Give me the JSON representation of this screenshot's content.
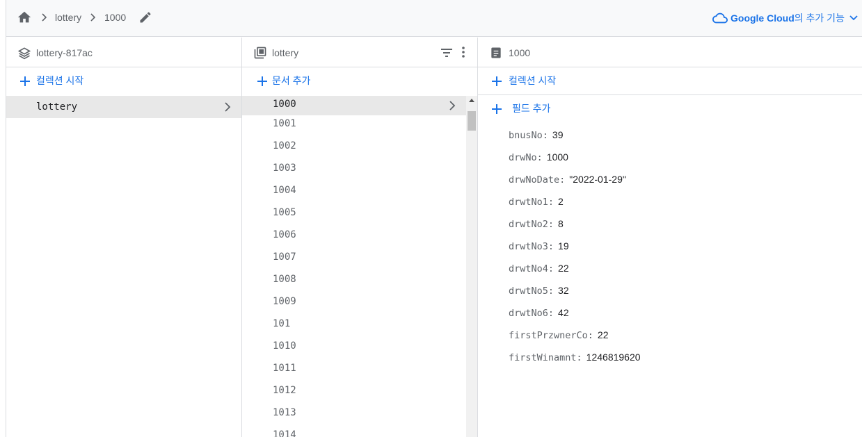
{
  "breadcrumb": {
    "items": [
      "lottery",
      "1000"
    ]
  },
  "google_cloud": {
    "brand": "Google Cloud",
    "rest": "의 추가 기능"
  },
  "panel_root": {
    "title": "lottery-817ac",
    "add_label": "컬렉션 시작",
    "collections": [
      {
        "label": "lottery"
      }
    ]
  },
  "panel_collection": {
    "title": "lottery",
    "add_label": "문서 추가",
    "documents": [
      "1000",
      "1001",
      "1002",
      "1003",
      "1004",
      "1005",
      "1006",
      "1007",
      "1008",
      "1009",
      "101",
      "1010",
      "1011",
      "1012",
      "1013",
      "1014"
    ]
  },
  "panel_document": {
    "title": "1000",
    "add_collection_label": "컬렉션 시작",
    "add_field_label": "필드 추가",
    "fields": [
      {
        "key": "bnusNo:",
        "value": "39"
      },
      {
        "key": "drwNo:",
        "value": "1000"
      },
      {
        "key": "drwNoDate:",
        "value": "\"2022-01-29\""
      },
      {
        "key": "drwtNo1:",
        "value": "2"
      },
      {
        "key": "drwtNo2:",
        "value": "8"
      },
      {
        "key": "drwtNo3:",
        "value": "19"
      },
      {
        "key": "drwtNo4:",
        "value": "22"
      },
      {
        "key": "drwtNo5:",
        "value": "32"
      },
      {
        "key": "drwtNo6:",
        "value": "42"
      },
      {
        "key": "firstPrzwnerCo:",
        "value": "22"
      },
      {
        "key": "firstWinamnt:",
        "value": "1246819620"
      }
    ]
  },
  "colors": {
    "accent": "#1a73e8",
    "selected_row": "#e8e8e8",
    "border": "#dadce0",
    "muted_text": "#5f6368"
  }
}
